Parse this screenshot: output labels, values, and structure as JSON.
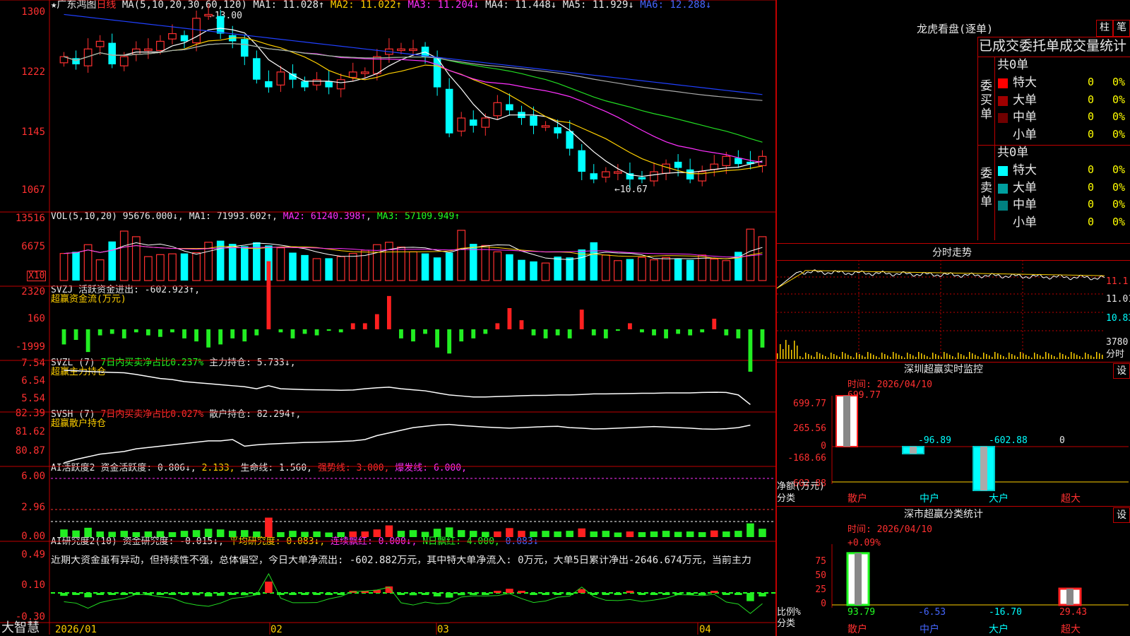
{
  "main": {
    "title": "★广东鸿图",
    "period": "日线",
    "ma_header": {
      "label": "MA(5,10,20,30,60,120)",
      "ma1": "MA1: 11.028↑",
      "ma2": "MA2: 11.022↑",
      "ma3": "MA3: 11.204↓",
      "ma4": "MA4: 11.448↓",
      "ma5": "MA5: 11.929↓",
      "ma6": "MA6: 12.288↓"
    },
    "yaxis": [
      "1300",
      "1222",
      "1145",
      "1067"
    ],
    "high_label": "13.00",
    "low_label": "←10.67"
  },
  "vol": {
    "label": "VOL(5,10,20)",
    "value": "95676.000↓",
    "ma1": "MA1: 71993.602↑",
    "ma2": "MA2: 61240.398↑",
    "ma3": "MA3: 57109.949↑",
    "yaxis": [
      "13516",
      "6675"
    ],
    "unit": "X10"
  },
  "svzj": {
    "line1": "SVZJ  活跃资金进出: -602.923↑,",
    "line2": "超赢资金流(万元)",
    "yaxis": [
      "2320",
      "160",
      "-1999"
    ]
  },
  "svzl": {
    "label": "SVZL (7)",
    "part2": "7日内买卖净占比0.237%",
    "part3": "主力持仓: 5.733↓,",
    "line2": "超赢主力持仓",
    "yaxis": [
      "7.54",
      "6.54",
      "5.54"
    ]
  },
  "svsh": {
    "label": "SVSH (7)",
    "part2": "7日内买卖净占比0.027%",
    "part3": "散户持仓: 82.294↑,",
    "line2": "超赢散户持仓",
    "yaxis": [
      "82.39",
      "81.62",
      "80.87"
    ]
  },
  "ai1": {
    "label": "AI活跃度2",
    "p1": "资金活跃度: 0.806↓,",
    "p2": "2.133,",
    "p3": "生命线: 1.560,",
    "p4": "强势线: 3.000,",
    "p5": "爆发线: 6.000,",
    "yaxis": [
      "6.00",
      "2.96",
      "0.00"
    ]
  },
  "ai2": {
    "label": "AI研究度2(10)",
    "p1": "资金研究度: -0.015↓,",
    "p2": "平均研究度: 0.083↓,",
    "p3": "连续飘红: 0.000↓,",
    "p4": "N日飘红: 4.000,",
    "p5": "0.083↓",
    "comment": "近期大资金虽有异动，但持续性不强，总体偏空，今日大单净流出: -602.882万元，其中特大单净流入: 0万元，大单5日累计净出-2646.674万元，当前主力",
    "yaxis": [
      "0.49",
      "0.10",
      "-0.30"
    ]
  },
  "xaxis": {
    "dates": [
      "2026/01",
      "02",
      "03",
      "04"
    ]
  },
  "brand": "大智慧",
  "dragon": {
    "title": "龙虎看盘(逐单)",
    "btn_bar": "柱",
    "btn_pen": "笔",
    "header": "已成交委托单成交量统计",
    "buy": {
      "side": "委买单",
      "total": "共0单",
      "rows": [
        {
          "name": "特大",
          "v": "0",
          "p": "0%",
          "color": "#ff0000"
        },
        {
          "name": "大单",
          "v": "0",
          "p": "0%",
          "color": "#a00000"
        },
        {
          "name": "中单",
          "v": "0",
          "p": "0%",
          "color": "#700000"
        },
        {
          "name": "小单",
          "v": "0",
          "p": "0%",
          "color": ""
        }
      ]
    },
    "sell": {
      "side": "委卖单",
      "total": "共0单",
      "rows": [
        {
          "name": "特大",
          "v": "0",
          "p": "0%",
          "color": "#00ffff"
        },
        {
          "name": "大单",
          "v": "0",
          "p": "0%",
          "color": "#00a0a0"
        },
        {
          "name": "中单",
          "v": "0",
          "p": "0%",
          "color": "#008080"
        },
        {
          "name": "小单",
          "v": "0",
          "p": "0%",
          "color": ""
        }
      ]
    }
  },
  "intraday": {
    "title": "分时走势",
    "yaxis": [
      "11.1",
      "11.01",
      "10.83"
    ],
    "vol": "3780",
    "vol_label": "分时"
  },
  "szmon": {
    "title": "深圳超赢实时监控",
    "btn": "设",
    "time": "时间: 2026/04/10",
    "yaxis": [
      "699.77",
      "265.56",
      "0",
      "-168.66",
      "-602.88"
    ],
    "vals": [
      "699.77",
      "-96.89",
      "-602.88",
      "0"
    ],
    "ylabel": "净额(万元)",
    "xlabel": "分类",
    "cats": [
      "散户",
      "中户",
      "大户",
      "超大"
    ]
  },
  "szcls": {
    "title": "深市超赢分类统计",
    "btn": "设",
    "time": "时间: 2026/04/10",
    "top_val": "+0.09%",
    "yaxis": [
      "75",
      "50",
      "25",
      "0"
    ],
    "vals": [
      "93.79",
      "-6.53",
      "-16.70",
      "29.43"
    ],
    "ylabel": "比例%",
    "xlabel": "分类",
    "cats": [
      "散户",
      "中户",
      "大户",
      "超大"
    ]
  },
  "chart_data": {
    "type": "candlestick",
    "title": "广东鸿图 日线",
    "ylim": [
      10.67,
      13.0
    ],
    "ma_lines": [
      "MA1",
      "MA2",
      "MA3",
      "MA4",
      "MA5",
      "MA6"
    ],
    "x": [
      "2026/01",
      "02",
      "03",
      "04"
    ],
    "close": [
      12.4,
      12.3,
      12.5,
      12.6,
      12.3,
      12.4,
      12.5,
      12.5,
      12.6,
      12.7,
      12.6,
      12.9,
      12.95,
      12.7,
      12.6,
      12.4,
      12.1,
      12.0,
      12.2,
      12.1,
      12.0,
      12.1,
      12.0,
      12.1,
      12.2,
      12.2,
      12.4,
      12.5,
      12.5,
      12.5,
      12.4,
      12.0,
      11.4,
      11.6,
      11.5,
      11.6,
      11.8,
      11.7,
      11.6,
      11.5,
      11.5,
      11.4,
      11.2,
      10.9,
      10.8,
      10.9,
      10.9,
      10.8,
      10.8,
      10.9,
      11.0,
      10.95,
      10.8,
      10.9,
      11.0,
      11.1,
      11.0,
      11.0,
      11.1
    ],
    "volume_x10": [
      6800,
      7200,
      9000,
      5200,
      9800,
      12400,
      11000,
      6000,
      6500,
      6700,
      6800,
      7000,
      9600,
      10000,
      9200,
      8600,
      9600,
      8800,
      8200,
      7000,
      6400,
      5500,
      5600,
      6000,
      6800,
      7600,
      9000,
      9600,
      8400,
      7200,
      6800,
      5800,
      7000,
      12600,
      9200,
      8800,
      7200,
      6600,
      5200,
      4800,
      4400,
      6000,
      5800,
      7800,
      9600,
      6400,
      5000,
      5400,
      5800,
      5200,
      5800,
      5400,
      5200,
      6400,
      5400,
      5000,
      7200,
      12900,
      11000
    ],
    "svzj": [
      -500,
      -350,
      -750,
      -200,
      -150,
      -300,
      -100,
      -200,
      -250,
      -100,
      -300,
      -400,
      -600,
      -500,
      -300,
      -400,
      -200,
      2250,
      -100,
      -300,
      -150,
      -200,
      -50,
      -100,
      200,
      200,
      500,
      1100,
      -300,
      -400,
      -150,
      -600,
      -800,
      -400,
      -300,
      -150,
      200,
      700,
      300,
      -200,
      -300,
      -200,
      -300,
      650,
      -200,
      -300,
      -50,
      200,
      -100,
      -200,
      -300,
      -150,
      -200,
      -100,
      350,
      -200,
      -300,
      -1400,
      -602.9
    ],
    "svzl": [
      7.4,
      7.38,
      7.35,
      7.32,
      7.3,
      7.28,
      7.2,
      7.1,
      7.0,
      6.95,
      6.85,
      6.8,
      6.75,
      6.7,
      6.65,
      6.6,
      6.5,
      6.65,
      6.5,
      6.48,
      6.46,
      6.45,
      6.44,
      6.43,
      6.44,
      6.5,
      6.55,
      6.58,
      6.5,
      6.45,
      6.4,
      6.3,
      6.2,
      6.15,
      6.1,
      6.1,
      6.12,
      6.14,
      6.16,
      6.18,
      6.18,
      6.2,
      6.2,
      6.22,
      6.25,
      6.25,
      6.26,
      6.27,
      6.28,
      6.28,
      6.3,
      6.3,
      6.3,
      6.32,
      6.33,
      6.32,
      6.2,
      5.733
    ],
    "svsh": [
      80.87,
      81.0,
      81.1,
      81.2,
      81.25,
      81.3,
      81.4,
      81.45,
      81.5,
      81.55,
      81.6,
      81.65,
      81.7,
      81.7,
      81.75,
      81.5,
      81.55,
      81.58,
      81.6,
      81.62,
      81.64,
      81.65,
      81.66,
      81.68,
      81.7,
      81.75,
      81.9,
      82.0,
      82.1,
      82.2,
      82.25,
      82.3,
      82.32,
      82.28,
      82.25,
      82.22,
      82.2,
      82.18,
      82.2,
      82.22,
      82.24,
      82.25,
      82.2,
      82.18,
      82.15,
      82.16,
      82.18,
      82.2,
      82.22,
      82.24,
      82.22,
      82.2,
      82.18,
      82.15,
      82.14,
      82.16,
      82.2,
      82.294
    ]
  }
}
